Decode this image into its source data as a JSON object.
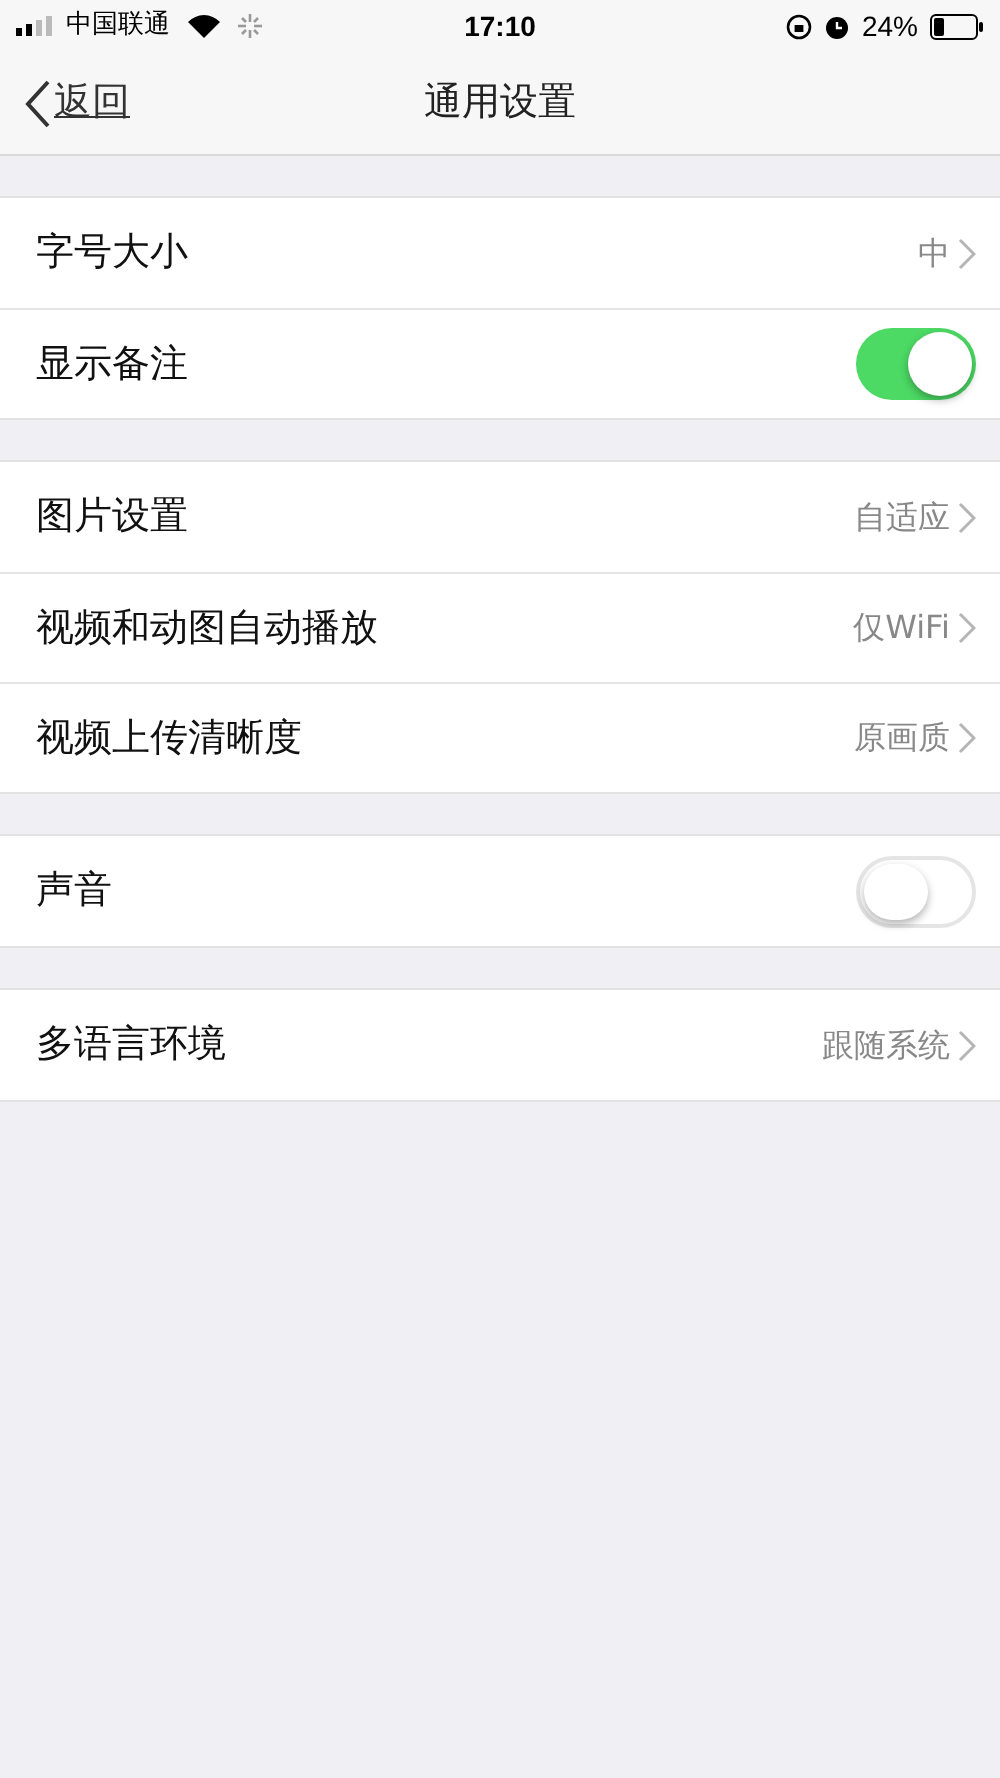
{
  "status_bar": {
    "carrier": "中国联通",
    "time": "17:10",
    "battery": "24%"
  },
  "nav": {
    "back": "返回",
    "title": "通用设置"
  },
  "groups": [
    {
      "rows": [
        {
          "kind": "value",
          "label": "字号大小",
          "value": "中"
        },
        {
          "kind": "toggle",
          "label": "显示备注",
          "on": true
        }
      ]
    },
    {
      "rows": [
        {
          "kind": "value",
          "label": "图片设置",
          "value": "自适应"
        },
        {
          "kind": "value",
          "label": "视频和动图自动播放",
          "value": "仅WiFi"
        },
        {
          "kind": "value",
          "label": "视频上传清晰度",
          "value": "原画质"
        }
      ]
    },
    {
      "rows": [
        {
          "kind": "toggle",
          "label": "声音",
          "on": false
        }
      ]
    },
    {
      "rows": [
        {
          "kind": "value",
          "label": "多语言环境",
          "value": "跟随系统"
        }
      ]
    }
  ]
}
